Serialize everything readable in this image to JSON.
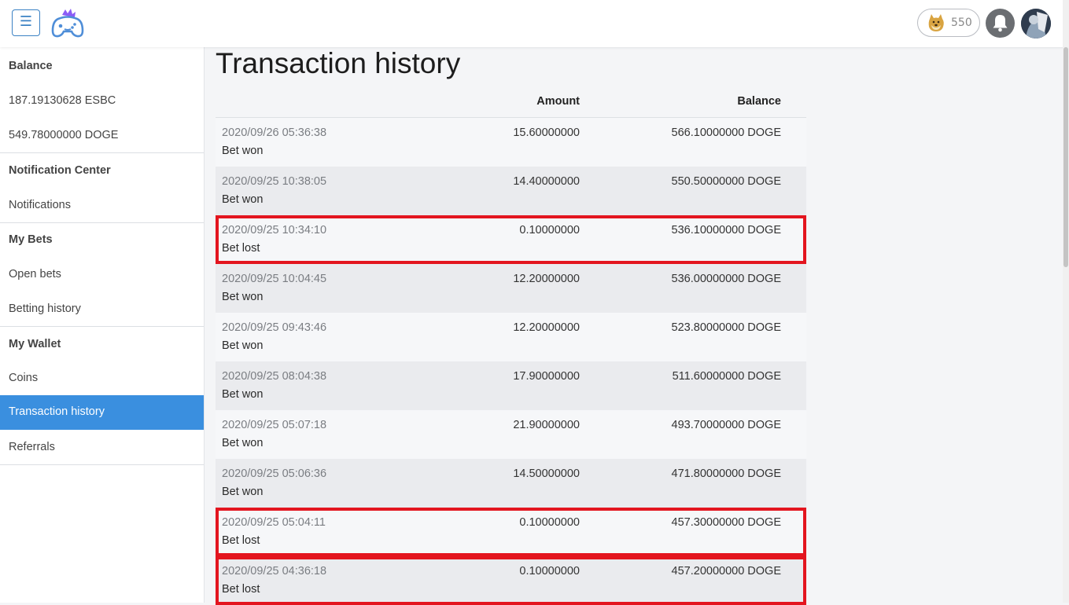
{
  "header": {
    "menu_icon": "hamburger-icon",
    "logo_icon": "gamepad-logo-icon",
    "coin_icon": "doge-coin-icon",
    "coin_count": "550",
    "bell_icon": "bell-icon",
    "avatar_icon": "user-avatar-icon"
  },
  "sidebar": {
    "sections": [
      {
        "heading": "Balance",
        "items": [
          "187.19130628 ESBC",
          "549.78000000 DOGE"
        ]
      },
      {
        "heading": "Notification Center",
        "items": [
          "Notifications"
        ]
      },
      {
        "heading": "My Bets",
        "items": [
          "Open bets",
          "Betting history"
        ]
      },
      {
        "heading": "My Wallet",
        "items": [
          "Coins",
          "Transaction history",
          "Referrals"
        ]
      }
    ],
    "active_item": "Transaction history",
    "active_color": "#3a8fdf"
  },
  "main": {
    "title": "Transaction history",
    "columns": {
      "amount": "Amount",
      "balance": "Balance"
    },
    "highlight_color": "#e3151f",
    "rows": [
      {
        "date": "2020/09/26 05:36:38",
        "desc": "Bet won",
        "amount": "15.60000000",
        "balance": "566.10000000 DOGE",
        "highlighted": false
      },
      {
        "date": "2020/09/25 10:38:05",
        "desc": "Bet won",
        "amount": "14.40000000",
        "balance": "550.50000000 DOGE",
        "highlighted": false
      },
      {
        "date": "2020/09/25 10:34:10",
        "desc": "Bet lost",
        "amount": "0.10000000",
        "balance": "536.10000000 DOGE",
        "highlighted": true
      },
      {
        "date": "2020/09/25 10:04:45",
        "desc": "Bet won",
        "amount": "12.20000000",
        "balance": "536.00000000 DOGE",
        "highlighted": false
      },
      {
        "date": "2020/09/25 09:43:46",
        "desc": "Bet won",
        "amount": "12.20000000",
        "balance": "523.80000000 DOGE",
        "highlighted": false
      },
      {
        "date": "2020/09/25 08:04:38",
        "desc": "Bet won",
        "amount": "17.90000000",
        "balance": "511.60000000 DOGE",
        "highlighted": false
      },
      {
        "date": "2020/09/25 05:07:18",
        "desc": "Bet won",
        "amount": "21.90000000",
        "balance": "493.70000000 DOGE",
        "highlighted": false
      },
      {
        "date": "2020/09/25 05:06:36",
        "desc": "Bet won",
        "amount": "14.50000000",
        "balance": "471.80000000 DOGE",
        "highlighted": false
      },
      {
        "date": "2020/09/25 05:04:11",
        "desc": "Bet lost",
        "amount": "0.10000000",
        "balance": "457.30000000 DOGE",
        "highlighted": true
      },
      {
        "date": "2020/09/25 04:36:18",
        "desc": "Bet lost",
        "amount": "0.10000000",
        "balance": "457.20000000 DOGE",
        "highlighted": true
      }
    ]
  }
}
